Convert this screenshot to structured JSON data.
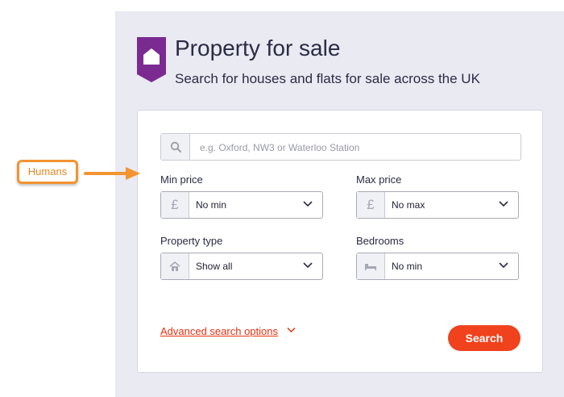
{
  "header": {
    "title": "Property for sale",
    "subtitle": "Search for houses and flats for sale across the UK",
    "logo_icon": "house-tag-icon",
    "logo_color": "#7b2a92"
  },
  "search": {
    "placeholder": "e.g. Oxford, NW3 or Waterloo Station",
    "value": "",
    "icon": "search-icon"
  },
  "filters": {
    "min_price": {
      "label": "Min price",
      "icon": "pound-icon",
      "glyph": "£",
      "value": "No min"
    },
    "max_price": {
      "label": "Max price",
      "icon": "pound-icon",
      "glyph": "£",
      "value": "No max"
    },
    "property_type": {
      "label": "Property type",
      "icon": "house-icon",
      "value": "Show all"
    },
    "bedrooms": {
      "label": "Bedrooms",
      "icon": "bed-icon",
      "value": "No min"
    }
  },
  "advanced_link": "Advanced search options",
  "search_button": "Search",
  "annotation": {
    "label": "Humans",
    "color": "#f29430"
  },
  "colors": {
    "accent": "#f0421d",
    "text": "#2b2c44",
    "panel_bg": "#e9eaf2"
  }
}
